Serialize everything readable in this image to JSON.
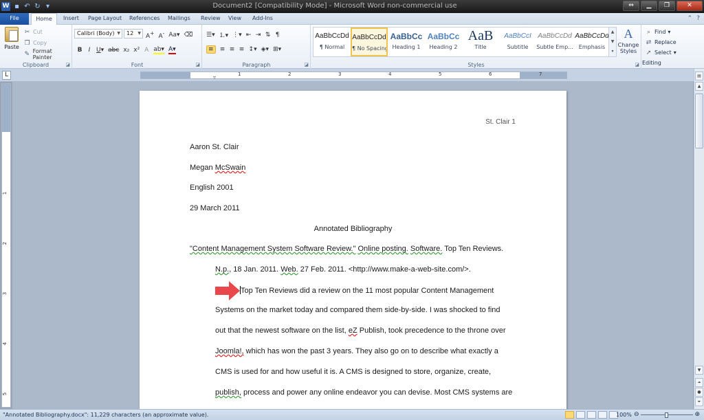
{
  "window": {
    "title": "Document2 [Compatibility Mode] - Microsoft Word non-commercial use"
  },
  "tabs": [
    "File",
    "Home",
    "Insert",
    "Page Layout",
    "References",
    "Mailings",
    "Review",
    "View",
    "Add-Ins"
  ],
  "ribbon": {
    "clipboard": {
      "paste": "Paste",
      "cut": "Cut",
      "copy": "Copy",
      "format_painter": "Format Painter",
      "label": "Clipboard"
    },
    "font": {
      "name": "Calibri (Body)",
      "size": "12",
      "label": "Font"
    },
    "paragraph": {
      "label": "Paragraph"
    },
    "styles": {
      "label": "Styles",
      "items": [
        {
          "sample": "AaBbCcDd",
          "name": "¶ Normal"
        },
        {
          "sample": "AaBbCcDd",
          "name": "¶ No Spacing"
        },
        {
          "sample": "AaBbCc",
          "name": "Heading 1"
        },
        {
          "sample": "AaBbCc",
          "name": "Heading 2"
        },
        {
          "sample": "AaB",
          "name": "Title"
        },
        {
          "sample": "AaBbCcI",
          "name": "Subtitle"
        },
        {
          "sample": "AaBbCcDd",
          "name": "Subtle Emp..."
        },
        {
          "sample": "AaBbCcDd",
          "name": "Emphasis"
        }
      ],
      "change_styles": "Change Styles"
    },
    "editing": {
      "find": "Find",
      "replace": "Replace",
      "select": "Select",
      "label": "Editing"
    }
  },
  "ruler": {
    "numbers": [
      "1",
      "2",
      "3",
      "4",
      "5",
      "6",
      "7"
    ],
    "vnumbers": [
      "1",
      "2",
      "3",
      "4",
      "5"
    ]
  },
  "document": {
    "header": "St. Clair 1",
    "author": "Aaron St. Clair",
    "instructor_first": "Megan ",
    "instructor_last": "McSwain",
    "course": "English 2001",
    "date": "29 March 2011",
    "title": "Annotated Bibliography",
    "citation1_a": "\"Content Management System Software Review.\"",
    "citation1_b": " ",
    "citation1_c": "Online posting.",
    "citation1_d": " ",
    "citation1_e": "Software.",
    "citation1_f": " Top Ten Reviews.",
    "citation2_a": "N.p.",
    "citation2_b": ", 18 Jan. 2011. ",
    "citation2_c": "Web.",
    "citation2_d": " 27 Feb. 2011. <http://www.make-a-web-site.com/>.",
    "p1": "Top Ten Reviews did a review on the 11 most popular Content Management",
    "p2": "Systems on the market today and compared them side-by-side. I was shocked to find",
    "p3_a": "out that the newest software on the list, ",
    "p3_b": "eZ",
    "p3_c": " Publish, took precedence to the throne over",
    "p4_a": "Joomla!,",
    "p4_b": " which has won the past 3 years. They also go on to describe what exactly a",
    "p5": "CMS is used for and how useful it is. A CMS is designed to store, organize, create,",
    "p6_a": "publish,",
    "p6_b": " process and power any online endeavor you can devise. Most CMS systems are"
  },
  "status": {
    "text": "\"Annotated Bibliography.docx\": 11,229 characters (an approximate value).",
    "zoom": "100%"
  },
  "colors": {
    "accent": "#2a5caa",
    "arrow": "#e8474b",
    "selected_style": "#f2c44f"
  }
}
